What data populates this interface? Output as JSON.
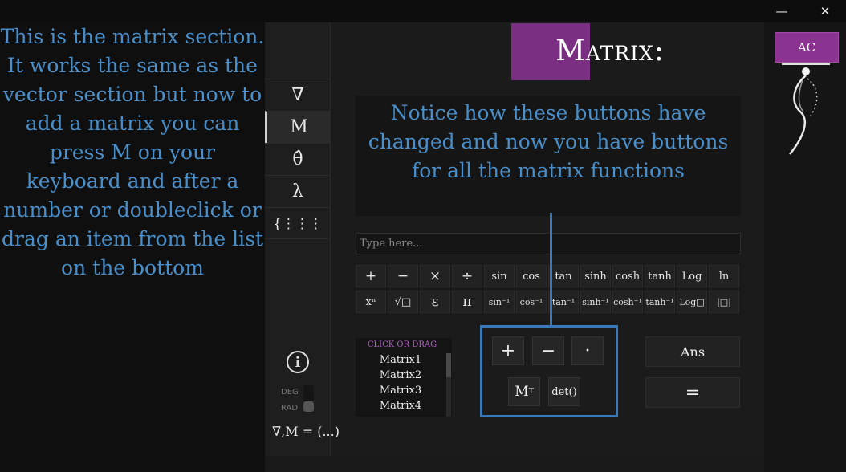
{
  "window": {
    "minimize_icon": "minimize-icon",
    "close_icon": "close-icon",
    "minimize_glyph": "—",
    "close_glyph": "✕"
  },
  "tutorial": {
    "left_text": "This is the matrix section. It works the same as the vector section but now to add a matrix you can press M on your keyboard and after a number or doubleclick or drag an item from the list on the bottom",
    "notice_text": "Notice how these buttons have changed and now you have buttons for all the matrix functions",
    "text_color": "#4a8fc9",
    "callout_color": "#3a78b8"
  },
  "nav": {
    "items": [
      {
        "label": "∇̄",
        "name": "vector"
      },
      {
        "label": "M",
        "name": "matrix"
      },
      {
        "label": "θ̂",
        "name": "theta"
      },
      {
        "label": "λ",
        "name": "lambda"
      },
      {
        "label": "{⋮⋮⋮",
        "name": "list"
      }
    ],
    "info_label": "i",
    "deg_label": "DEG",
    "rad_label": "RAD",
    "angle_mode": "RAD"
  },
  "main": {
    "title": "Matrix:",
    "title_accent": "#7a2f82",
    "input_placeholder": "Type here...",
    "fn_row_1": [
      "+",
      "−",
      "×",
      "÷",
      "sin",
      "cos",
      "tan",
      "sinh",
      "cosh",
      "tanh",
      "Log",
      "ln"
    ],
    "fn_row_2": [
      "xⁿ",
      "√□",
      "ε",
      "π",
      "sin⁻¹",
      "cos⁻¹",
      "tan⁻¹",
      "sinh⁻¹",
      "cosh⁻¹",
      "tanh⁻¹",
      "Log□",
      "|□|"
    ],
    "list": {
      "header": "CLICK OR DRAG",
      "items": [
        "Matrix1",
        "Matrix2",
        "Matrix3",
        "Matrix4"
      ]
    },
    "matrix_ops": {
      "plus": "+",
      "minus": "−",
      "dot": "·",
      "transpose": "M",
      "transpose_sup": "T",
      "det": "det()"
    },
    "ans_label": "Ans",
    "equals_label": "=",
    "status_text": "∇̄,M = (...)"
  },
  "right_panel": {
    "ac_label": "AC",
    "ac_color": "#8b3390"
  }
}
